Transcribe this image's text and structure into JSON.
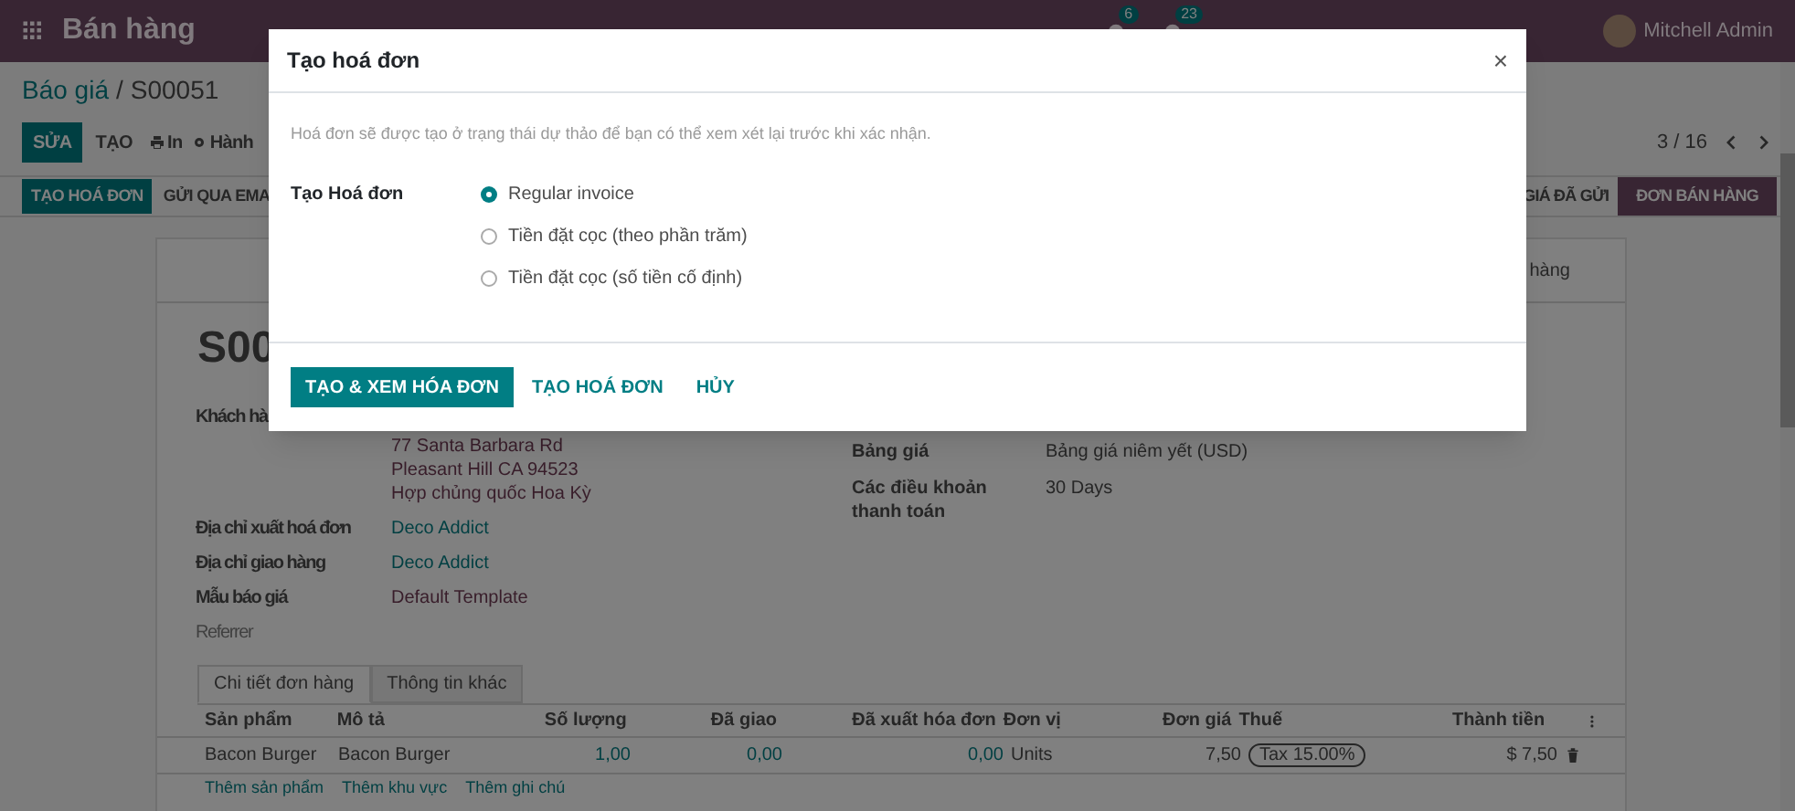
{
  "navbar": {
    "app_name": "Bán hàng",
    "badges": [
      "6",
      "23"
    ],
    "user": "Mitchell Admin"
  },
  "breadcrumb": {
    "parent": "Báo giá",
    "separator": "/",
    "current": "S00051"
  },
  "toolbar": {
    "buttons": [
      {
        "label": "SỬA",
        "kind": "primary"
      },
      {
        "label": "TẠO",
        "kind": "plain"
      },
      {
        "label": "In",
        "kind": "print"
      },
      {
        "label": "Hành",
        "kind": "gear"
      }
    ],
    "pager": "3 / 16"
  },
  "status_bar": {
    "actions": [
      {
        "label": "TẠO HOÁ ĐƠN",
        "kind": "primary"
      },
      {
        "label": "GỬI QUA EMA",
        "kind": "plain"
      }
    ],
    "stages": [
      {
        "label": "GIÁ ĐÃ GỬI",
        "selected": false
      },
      {
        "label": "ĐƠN BÁN HÀNG",
        "selected": true
      }
    ]
  },
  "sheet": {
    "smart_button": "hàng",
    "title": "S00",
    "left_fields": [
      {
        "label": "Khách hà",
        "lines": [
          "77 Santa Barbara Rd",
          "Pleasant Hill CA 94523",
          "Hợp chủng quốc Hoa Kỳ"
        ],
        "kind": "address"
      },
      {
        "label": "Địa chỉ xuất hoá đơn",
        "lines": [
          "Deco Addict"
        ],
        "kind": "link"
      },
      {
        "label": "Địa chỉ giao hàng",
        "lines": [
          "Deco Addict"
        ],
        "kind": "link"
      },
      {
        "label": "Mẫu báo giá",
        "lines": [
          "Default Template"
        ],
        "kind": "text"
      },
      {
        "label": "Referrer",
        "kind": "muted"
      }
    ],
    "right_fields": [
      {
        "label": "Bảng giá",
        "value": "Bảng giá niêm yết (USD)"
      },
      {
        "label": "Các điều khoản thanh toán",
        "value": "30 Days"
      }
    ]
  },
  "tabs": [
    {
      "label": "Chi tiết đơn hàng",
      "selected": true
    },
    {
      "label": "Thông tin khác",
      "selected": false
    }
  ],
  "table": {
    "columns": [
      "Sản phẩm",
      "Mô tả",
      "Số lượng",
      "Đã giao",
      "Đã xuất hóa đơn",
      "Đơn vị",
      "Đơn giá",
      "Thuế",
      "Thành tiền"
    ],
    "rows": [
      [
        "Bacon Burger",
        "Bacon Burger",
        "1,00",
        "0,00",
        "0,00",
        "Units",
        "7,50",
        "Tax 15.00%",
        "$ 7,50"
      ]
    ],
    "add_links": [
      "Thêm sản phẩm",
      "Thêm khu vực",
      "Thêm ghi chú"
    ]
  },
  "dialog": {
    "title": "Tạo hoá đơn",
    "close": "×",
    "note": "Hoá đơn sẽ được tạo ở trạng thái dự thảo để bạn có thể xem xét lại trước khi xác nhận.",
    "field_label": "Tạo Hoá đơn",
    "options": [
      {
        "label": "Regular invoice",
        "selected": true
      },
      {
        "label": "Tiền đặt cọc (theo phần trăm)",
        "selected": false
      },
      {
        "label": "Tiền đặt cọc (số tiền cố định)",
        "selected": false
      }
    ],
    "buttons": [
      {
        "label": "TẠO & XEM HÓA ĐƠN",
        "kind": "primary"
      },
      {
        "label": "TẠO HOÁ ĐƠN",
        "kind": "secondary"
      },
      {
        "label": "HỦY",
        "kind": "secondary"
      }
    ]
  }
}
